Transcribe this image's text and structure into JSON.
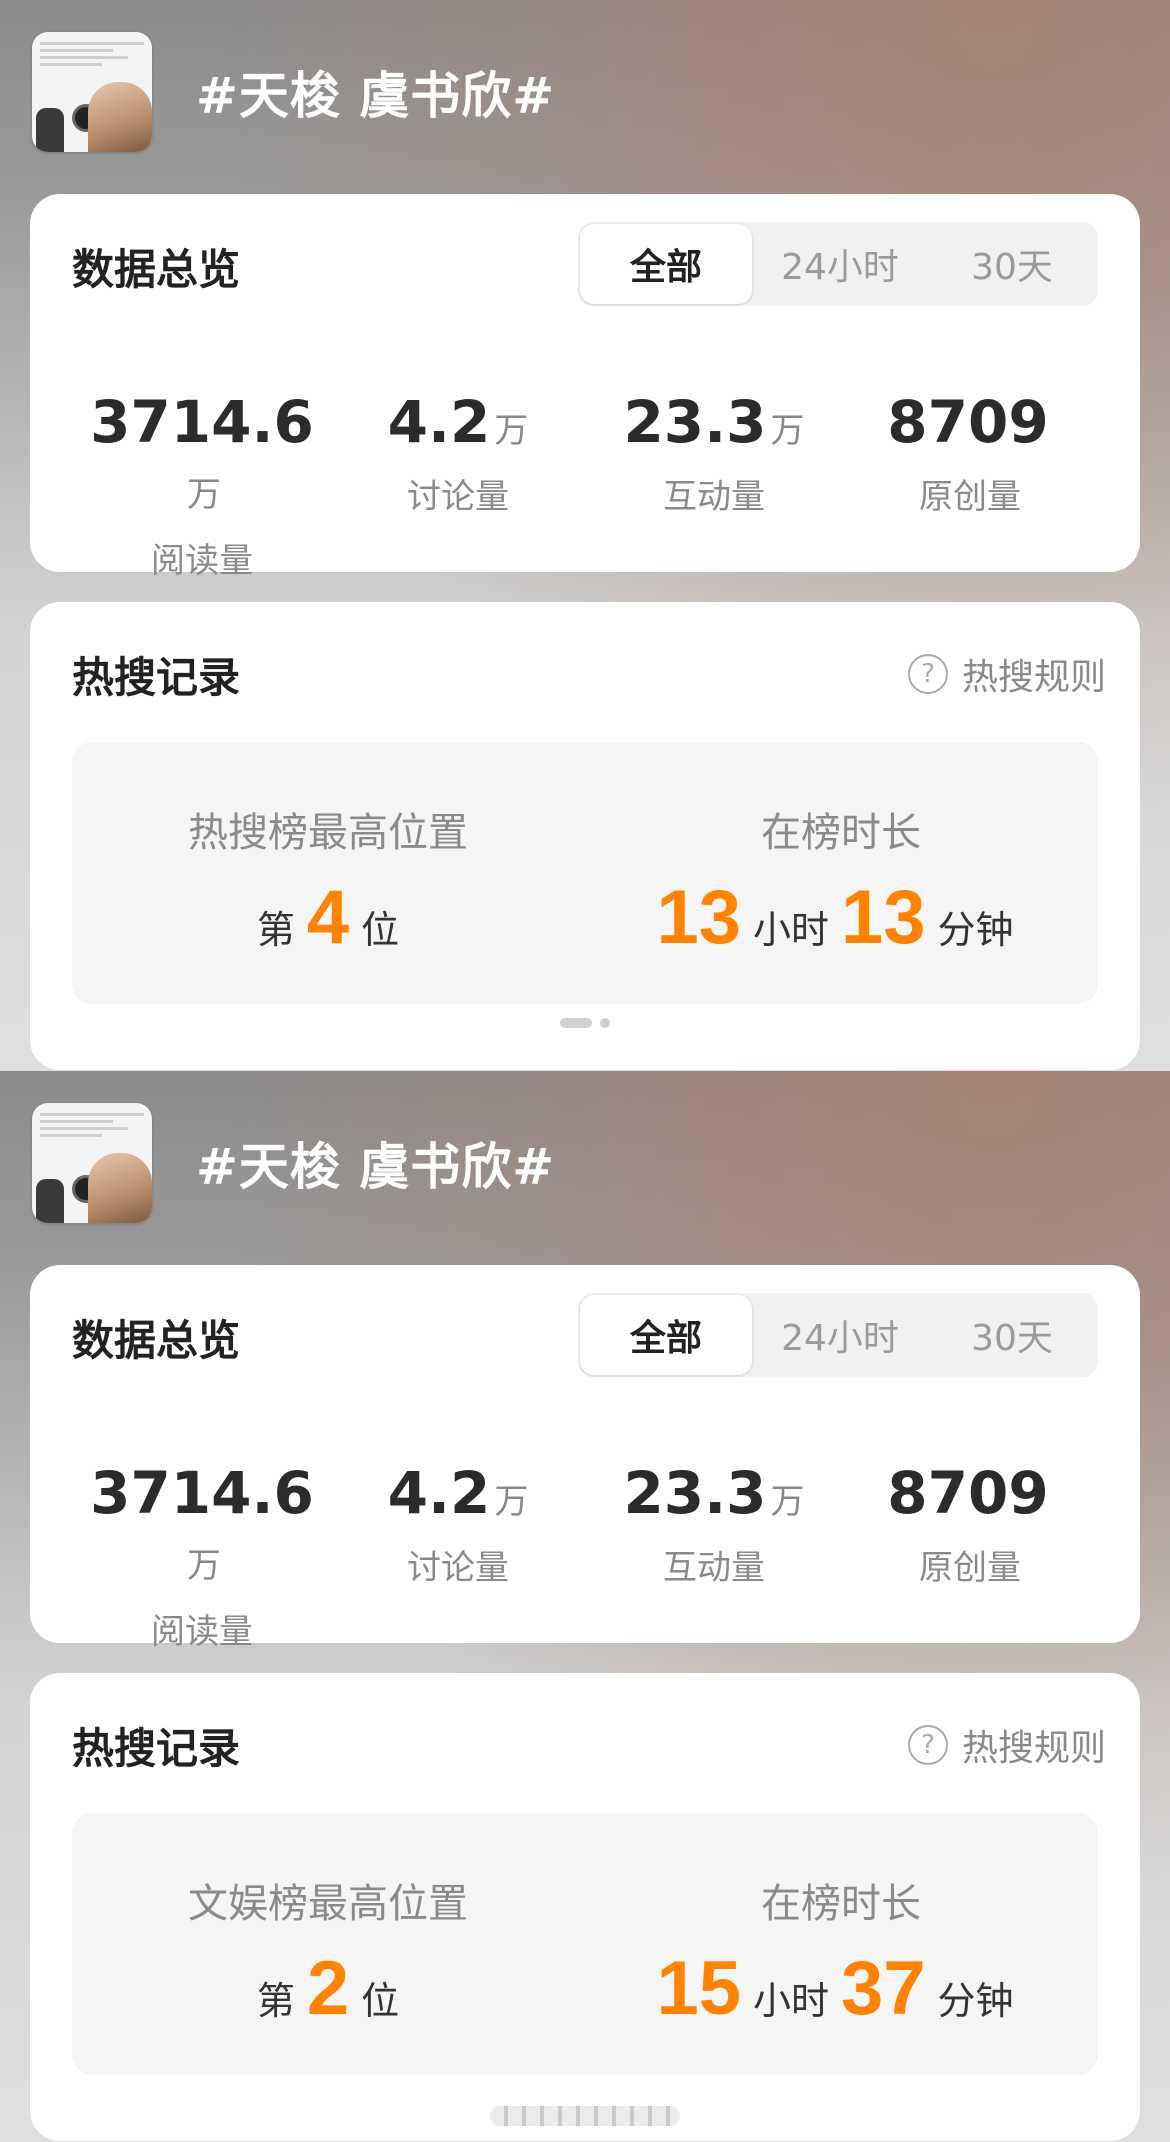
{
  "panels": [
    {
      "topic_title": "#天梭 虞书欣#",
      "overview": {
        "title": "数据总览",
        "tabs": [
          "全部",
          "24小时",
          "30天"
        ],
        "active_tab": "全部",
        "stats": [
          {
            "value": "3714.6",
            "unit": "万",
            "label": "阅读量"
          },
          {
            "value": "4.2",
            "unit": "万",
            "label": "讨论量"
          },
          {
            "value": "23.3",
            "unit": "万",
            "label": "互动量"
          },
          {
            "value": "8709",
            "unit": "",
            "label": "原创量"
          }
        ]
      },
      "hot": {
        "title": "热搜记录",
        "rules_label": "热搜规则",
        "rank_caption": "热搜榜最高位置",
        "rank_prefix": "第",
        "rank_value": "4",
        "rank_suffix": "位",
        "duration_caption": "在榜时长",
        "hours": "13",
        "hours_unit": "小时",
        "minutes": "13",
        "minutes_unit": "分钟"
      }
    },
    {
      "topic_title": "#天梭 虞书欣#",
      "overview": {
        "title": "数据总览",
        "tabs": [
          "全部",
          "24小时",
          "30天"
        ],
        "active_tab": "全部",
        "stats": [
          {
            "value": "3714.6",
            "unit": "万",
            "label": "阅读量"
          },
          {
            "value": "4.2",
            "unit": "万",
            "label": "讨论量"
          },
          {
            "value": "23.3",
            "unit": "万",
            "label": "互动量"
          },
          {
            "value": "8709",
            "unit": "",
            "label": "原创量"
          }
        ]
      },
      "hot": {
        "title": "热搜记录",
        "rules_label": "热搜规则",
        "rank_caption": "文娱榜最高位置",
        "rank_prefix": "第",
        "rank_value": "2",
        "rank_suffix": "位",
        "duration_caption": "在榜时长",
        "hours": "15",
        "hours_unit": "小时",
        "minutes": "37",
        "minutes_unit": "分钟"
      }
    }
  ],
  "colors": {
    "accent": "#ff8200",
    "card_bg": "#ffffff",
    "inner_box_bg": "#f5f5f5"
  }
}
